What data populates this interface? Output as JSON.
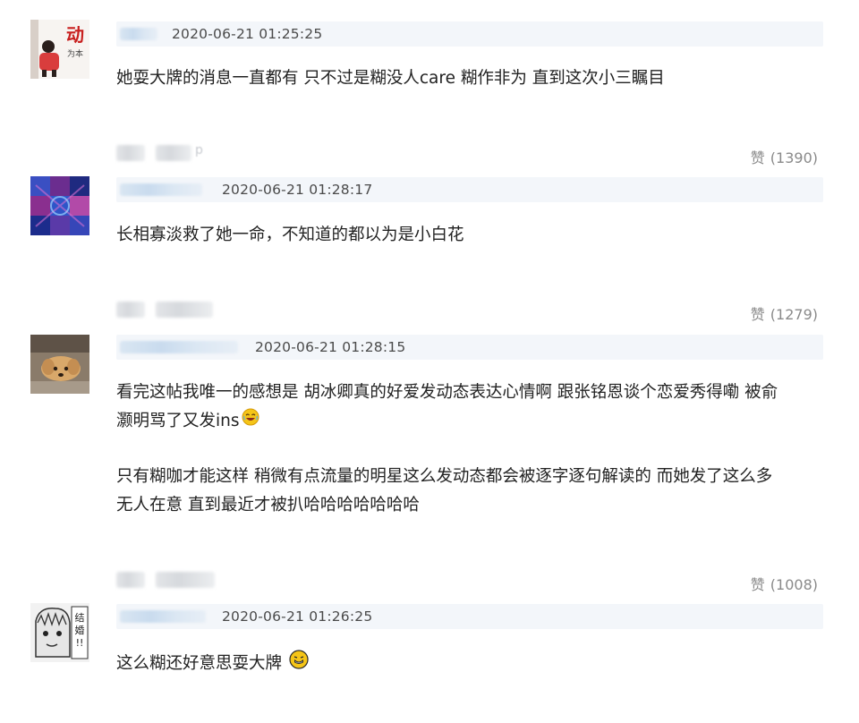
{
  "comments": [
    {
      "timestamp": "2020-06-21 01:25:25",
      "text": "她耍大牌的消息一直都有 只不过是糊没人care 糊作非为 直到这次小三瞩目",
      "avatar_text": "动",
      "avatar_subtext": "为本",
      "reply_tail": "",
      "likes_icon": "赞",
      "likes": "(1390)"
    },
    {
      "timestamp": "2020-06-21 01:28:17",
      "text": "长相寡淡救了她一命，不知道的都以为是小白花",
      "reply_tail": "p",
      "likes_icon": "赞",
      "likes": "(1279)"
    },
    {
      "timestamp": "2020-06-21 01:28:15",
      "text_lines": [
        "看完这帖我唯一的感想是 胡冰卿真的好爱发动态表达心情啊 跟张铭恩谈个恋爱秀得嘞 被俞",
        "灏明骂了又发ins",
        "只有糊咖才能这样 稍微有点流量的明星这么发动态都会被逐字逐句解读的 而她发了这么多",
        "无人在意 直到最近才被扒哈哈哈哈哈哈哈"
      ],
      "likes_icon": "赞",
      "likes": "(1008)"
    },
    {
      "timestamp": "2020-06-21 01:26:25",
      "text": "这么糊还好意思耍大牌",
      "avatar_text_1": "结",
      "avatar_text_2": "婚",
      "avatar_text_3": "!!"
    }
  ],
  "icons": {
    "laugh_emoji": "laughing-emoji",
    "awkward_emoji": "awkward-emoji"
  },
  "colors": {
    "meta_bar": "#f3f6fa",
    "like_text": "#8a8a8a",
    "emoji_yellow": "#f5c518"
  }
}
